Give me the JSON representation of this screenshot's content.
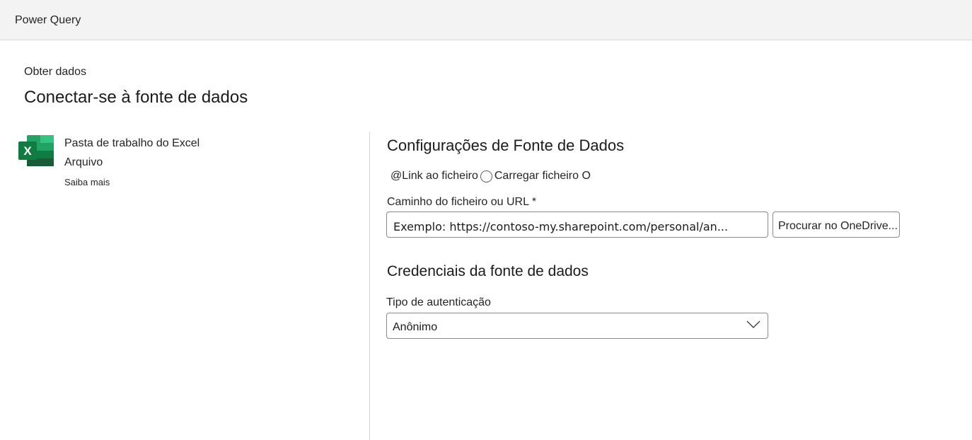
{
  "app": {
    "title": "Power Query"
  },
  "header": {
    "subtitle": "Obter dados",
    "title": "Conectar-se à fonte de dados"
  },
  "connector": {
    "icon": "excel-icon",
    "name": "Pasta de trabalho do Excel",
    "category": "Arquivo",
    "learn_more": "Saiba mais"
  },
  "settings": {
    "title": "Configurações de Fonte de Dados",
    "radio_left_text": "@Link ao ficheiro",
    "radio_right_text": "Carregar ficheiro O",
    "path_label": "Caminho do ficheiro ou URL *",
    "path_placeholder": "Exemplo: https://contoso-my.sharepoint.com/personal/an...",
    "browse_label": "Procurar no OneDrive..."
  },
  "credentials": {
    "title": "Credenciais da fonte de dados",
    "auth_label": "Tipo de autenticação",
    "auth_value": "Anônimo"
  },
  "colors": {
    "excel_dark": "#107C41",
    "excel_mid": "#21A366",
    "excel_light": "#33C481",
    "excel_deep": "#185C37"
  }
}
